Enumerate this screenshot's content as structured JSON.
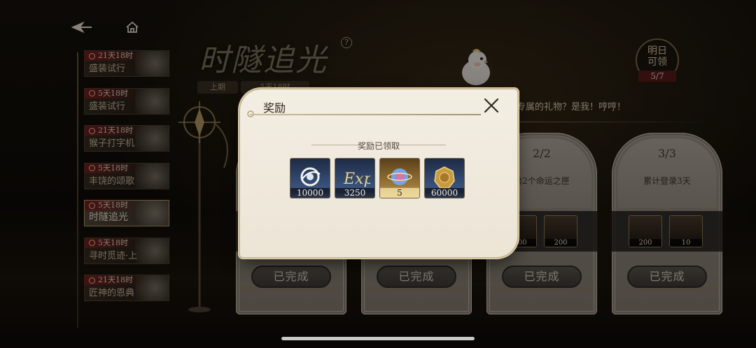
{
  "nav": {
    "back_icon": "back-arrow-icon",
    "home_icon": "home-icon"
  },
  "event": {
    "title": "时隧追光",
    "help_label": "?",
    "prev_period": "上期",
    "current_period": "5天18时"
  },
  "sidebar": {
    "items": [
      {
        "timer": "21天18时",
        "label": "盛装试行",
        "active": false
      },
      {
        "timer": "5天18时",
        "label": "盛装试行",
        "active": false
      },
      {
        "timer": "21天18时",
        "label": "猴子打字机",
        "active": false
      },
      {
        "timer": "5天18时",
        "label": "丰饶的颂歌",
        "active": false
      },
      {
        "timer": "5天18时",
        "label": "时隧追光",
        "active": true
      },
      {
        "timer": "5天18时",
        "label": "寻时觅迹·上",
        "active": false
      },
      {
        "timer": "21天18时",
        "label": "匠神的恩典",
        "active": false
      }
    ]
  },
  "tomorrow": {
    "line1": "明日",
    "line2": "可领",
    "count": "5/7"
  },
  "mascot": {
    "message": "专属的礼物？是我！哼哼！"
  },
  "cards": [
    {
      "progress": "",
      "desc": "",
      "rewards": [],
      "button": "已完成"
    },
    {
      "progress": "",
      "desc": "",
      "rewards": [],
      "button": "已完成"
    },
    {
      "progress": "2/2",
      "desc": "启2个命运之匣",
      "rewards": [
        {
          "qty": "200"
        },
        {
          "qty": "200"
        }
      ],
      "button": "已完成"
    },
    {
      "progress": "3/3",
      "desc": "累计登录3天",
      "rewards": [
        {
          "qty": "200"
        },
        {
          "qty": "10"
        }
      ],
      "button": "已完成"
    }
  ],
  "modal": {
    "title": "奖励",
    "close_icon": "close-icon",
    "subtitle": "奖励已领取",
    "rewards": [
      {
        "icon": "coin-ring-icon",
        "qty": "10000",
        "rarity_color": "#3d5a86"
      },
      {
        "icon": "exp-icon",
        "qty": "3250",
        "rarity_color": "#3d5a86"
      },
      {
        "icon": "crystal-orb-icon",
        "qty": "5",
        "rarity_color": "#d6b35f"
      },
      {
        "icon": "gold-coin-icon",
        "qty": "60000",
        "rarity_color": "#3d5a86"
      }
    ]
  },
  "colors": {
    "accent_gold": "#c9b78e",
    "modal_bg": "#f3eee3",
    "badge_red": "#7a1d1d"
  }
}
